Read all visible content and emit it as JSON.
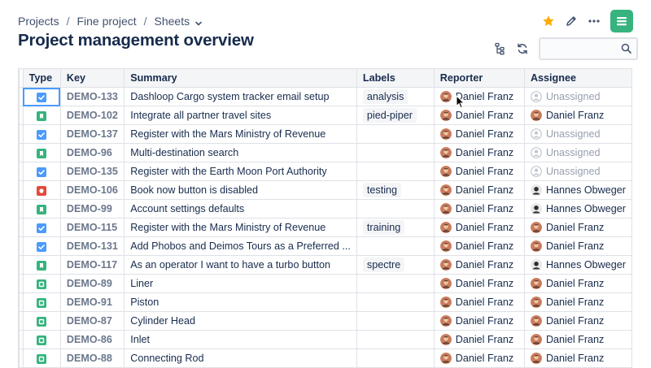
{
  "breadcrumb": {
    "items": [
      "Projects",
      "Fine project",
      "Sheets"
    ],
    "separator": "/"
  },
  "page": {
    "title": "Project management overview"
  },
  "search": {
    "placeholder": "",
    "value": ""
  },
  "colors": {
    "task": "#4c9aff",
    "story": "#36b37e",
    "bug": "#e5493a",
    "subtask": "#36b37e",
    "star": "#ffab00",
    "logo": "#36b37e"
  },
  "table": {
    "columns": [
      "Type",
      "Key",
      "Summary",
      "Labels",
      "Reporter",
      "Assignee"
    ],
    "rows": [
      {
        "type": "task",
        "key": "DEMO-133",
        "summary": "Dashloop Cargo system tracker email setup",
        "label": "analysis",
        "reporter": "Daniel Franz",
        "assignee": "Unassigned",
        "assignee_avatar": "none"
      },
      {
        "type": "story",
        "key": "DEMO-102",
        "summary": "Integrate all partner travel sites",
        "label": "pied-piper",
        "reporter": "Daniel Franz",
        "assignee": "Daniel Franz",
        "assignee_avatar": "daniel"
      },
      {
        "type": "task",
        "key": "DEMO-137",
        "summary": "Register with the Mars Ministry of Revenue",
        "label": "",
        "reporter": "Daniel Franz",
        "assignee": "Unassigned",
        "assignee_avatar": "none"
      },
      {
        "type": "story",
        "key": "DEMO-96",
        "summary": "Multi-destination search",
        "label": "",
        "reporter": "Daniel Franz",
        "assignee": "Unassigned",
        "assignee_avatar": "none"
      },
      {
        "type": "task",
        "key": "DEMO-135",
        "summary": "Register with the Earth Moon Port Authority",
        "label": "",
        "reporter": "Daniel Franz",
        "assignee": "Unassigned",
        "assignee_avatar": "none"
      },
      {
        "type": "bug",
        "key": "DEMO-106",
        "summary": "Book now button is disabled",
        "label": "testing",
        "reporter": "Daniel Franz",
        "assignee": "Hannes Obweger",
        "assignee_avatar": "hannes"
      },
      {
        "type": "story",
        "key": "DEMO-99",
        "summary": "Account settings defaults",
        "label": "",
        "reporter": "Daniel Franz",
        "assignee": "Hannes Obweger",
        "assignee_avatar": "hannes"
      },
      {
        "type": "task",
        "key": "DEMO-115",
        "summary": "Register with the Mars Ministry of Revenue",
        "label": "training",
        "reporter": "Daniel Franz",
        "assignee": "Daniel Franz",
        "assignee_avatar": "daniel"
      },
      {
        "type": "task",
        "key": "DEMO-131",
        "summary": "Add Phobos and Deimos Tours as a Preferred ...",
        "label": "",
        "reporter": "Daniel Franz",
        "assignee": "Daniel Franz",
        "assignee_avatar": "daniel"
      },
      {
        "type": "story",
        "key": "DEMO-117",
        "summary": "As an operator I want to have a turbo button",
        "label": "spectre",
        "reporter": "Daniel Franz",
        "assignee": "Hannes Obweger",
        "assignee_avatar": "hannes"
      },
      {
        "type": "subtask",
        "key": "DEMO-89",
        "summary": "Liner",
        "label": "",
        "reporter": "Daniel Franz",
        "assignee": "Daniel Franz",
        "assignee_avatar": "daniel"
      },
      {
        "type": "subtask",
        "key": "DEMO-91",
        "summary": "Piston",
        "label": "",
        "reporter": "Daniel Franz",
        "assignee": "Daniel Franz",
        "assignee_avatar": "daniel"
      },
      {
        "type": "subtask",
        "key": "DEMO-87",
        "summary": "Cylinder Head",
        "label": "",
        "reporter": "Daniel Franz",
        "assignee": "Daniel Franz",
        "assignee_avatar": "daniel"
      },
      {
        "type": "subtask",
        "key": "DEMO-86",
        "summary": "Inlet",
        "label": "",
        "reporter": "Daniel Franz",
        "assignee": "Daniel Franz",
        "assignee_avatar": "daniel"
      },
      {
        "type": "subtask",
        "key": "DEMO-88",
        "summary": "Connecting Rod",
        "label": "",
        "reporter": "Daniel Franz",
        "assignee": "Daniel Franz",
        "assignee_avatar": "daniel"
      }
    ]
  }
}
